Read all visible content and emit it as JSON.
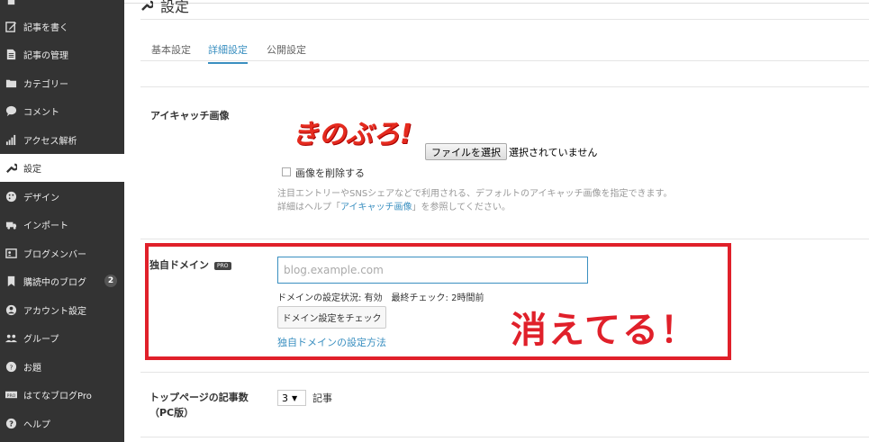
{
  "sidebar": {
    "items": [
      {
        "label": "",
        "icon": "home-icon"
      },
      {
        "label": "記事を書く",
        "icon": "pencil-icon"
      },
      {
        "label": "記事の管理",
        "icon": "document-icon"
      },
      {
        "label": "カテゴリー",
        "icon": "folder-icon"
      },
      {
        "label": "コメント",
        "icon": "comment-icon"
      },
      {
        "label": "アクセス解析",
        "icon": "chart-icon"
      },
      {
        "label": "設定",
        "icon": "wrench-icon"
      },
      {
        "label": "デザイン",
        "icon": "palette-icon"
      },
      {
        "label": "インポート",
        "icon": "truck-icon"
      },
      {
        "label": "ブログメンバー",
        "icon": "members-icon"
      },
      {
        "label": "購読中のブログ",
        "icon": "bookmark-icon",
        "badge": "2"
      },
      {
        "label": "アカウント設定",
        "icon": "account-icon"
      },
      {
        "label": "グループ",
        "icon": "group-icon"
      },
      {
        "label": "お題",
        "icon": "topic-icon"
      },
      {
        "label": "はてなブログPro",
        "icon": "pro-icon"
      },
      {
        "label": "ヘルプ",
        "icon": "help-icon"
      }
    ]
  },
  "header": {
    "title": "設定",
    "icon": "wrench-icon"
  },
  "tabs": [
    {
      "label": "基本設定"
    },
    {
      "label": "詳細設定"
    },
    {
      "label": "公開設定"
    }
  ],
  "eyecatch": {
    "label": "アイキャッチ画像",
    "logo_text": "きのぶろ!",
    "file_button": "ファイルを選択",
    "file_status": "選択されていません",
    "delete_label": "画像を削除する",
    "help_line1": "注目エントリーやSNSシェアなどで利用される、デフォルトのアイキャッチ画像を指定できます。",
    "help_prefix": "詳細はヘルプ「",
    "help_link": "アイキャッチ画像",
    "help_suffix": "」を参照してください。"
  },
  "domain": {
    "label": "独自ドメイン",
    "badge": "PRO",
    "placeholder": "blog.example.com",
    "status": "ドメインの設定状況: 有効　最終チェック: 2時間前",
    "check_button": "ドメイン設定をチェック",
    "help_link": "独自ドメインの設定方法"
  },
  "annotation": {
    "text": "消えてる！",
    "color": "#e0202a"
  },
  "top_page": {
    "label_line1": "トップページの記事数",
    "label_line2": "（PC版）",
    "select_value": "3",
    "unit": "記事"
  },
  "colors": {
    "accent": "#3a8fc0",
    "sidebar_bg": "#333333",
    "annotation_red": "#e0202a"
  }
}
